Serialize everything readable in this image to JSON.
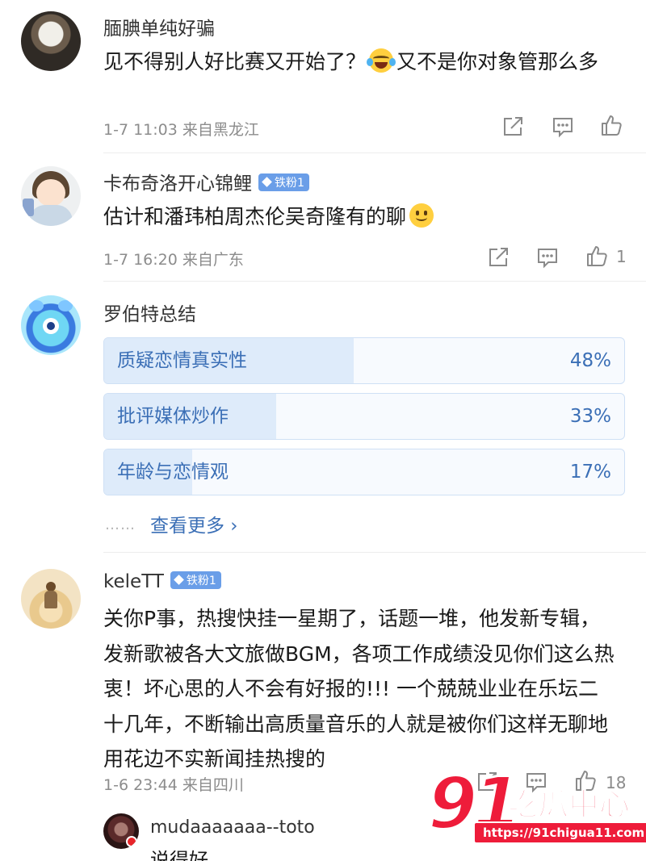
{
  "comments": [
    {
      "author": "腼腆单纯好骗",
      "text_before_emoji": "见不得别人好比赛又开始了？",
      "emoji": "crying-laughing-emoji",
      "text_after_emoji": "又不是你对象管那么多",
      "time": "1-7 11:03",
      "location": "来自黑龙江",
      "likes": ""
    },
    {
      "author": "卡布奇洛开心锦鲤",
      "badge": "铁粉1",
      "text_before_emoji": "估计和潘玮柏周杰伦吴奇隆有的聊",
      "emoji": "smile-emoji",
      "time": "1-7 16:20",
      "location": "来自广东",
      "likes": "1"
    },
    {
      "author": "keleTT",
      "badge": "铁粉1",
      "text": "关你P事，热搜快挂一星期了，话题一堆，他发新专辑，发新歌被各大文旅做BGM，各项工作成绩没见你们这么热衷！坏心思的人不会有好报的!!! 一个兢兢业业在乐坛二十几年，不断输出高质量音乐的人就是被你们这样无聊地用花边不实新闻挂热搜的",
      "time": "1-6 23:44",
      "location": "来自四川",
      "likes": "18"
    }
  ],
  "summary": {
    "author": "罗伯特总结",
    "poll": [
      {
        "label": "质疑恋情真实性",
        "percent_text": "48%",
        "percent": 48
      },
      {
        "label": "批评媒体炒作",
        "percent_text": "33%",
        "percent": 33
      },
      {
        "label": "年龄与恋情观",
        "percent_text": "17%",
        "percent": 17
      }
    ],
    "more_dots": "……",
    "more_label": "查看更多 ›"
  },
  "reply": {
    "author": "mudaaaaaaa--toto",
    "text": "说得好"
  },
  "watermark": {
    "logo_number": "91",
    "logo_text": "吃瓜中心",
    "url": "https://91chigua11.com"
  },
  "colors": {
    "accent": "#3b6fb6",
    "badge": "#6a9ee8",
    "poll_fill": "#deebfa",
    "watermark_red": "#ee1c3a"
  },
  "icons": [
    "share-icon",
    "comment-icon",
    "like-icon"
  ]
}
